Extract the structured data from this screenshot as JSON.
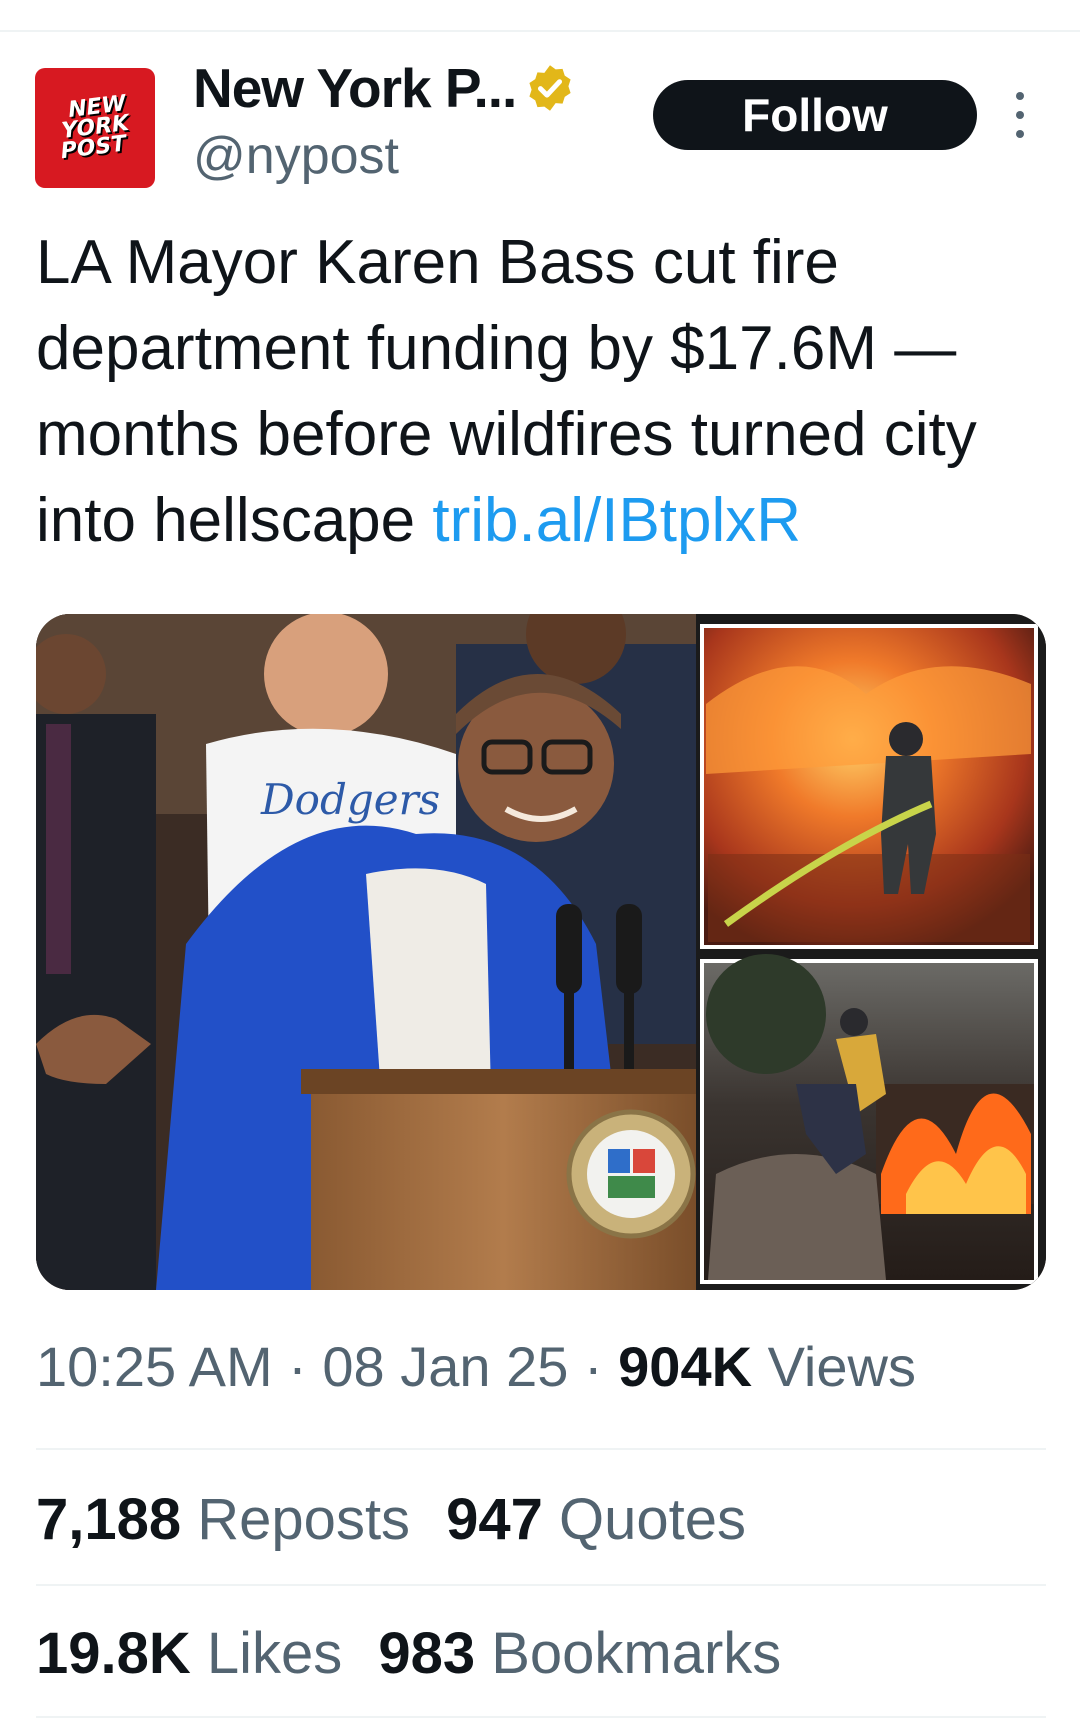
{
  "account": {
    "logo_lines": [
      "NEW",
      "YORK",
      "POST"
    ],
    "display_name": "New York P...",
    "handle": "@nypost",
    "verified_color": "#e2b719"
  },
  "follow_label": "Follow",
  "tweet": {
    "text": "LA Mayor Karen Bass cut fire department funding by $17.6M — months before wildfires turned city into hellscape",
    "link": "trib.al/IBtplxR",
    "link_color": "#1d9bf0"
  },
  "media": {
    "main_image": "mayor-at-podium-photo",
    "jersey_text": "Dodgers",
    "inset_images": [
      "firefighter-in-flames-photo",
      "firefighter-jumping-wall-photo"
    ]
  },
  "meta": {
    "time": "10:25 AM",
    "date": "08 Jan 25",
    "views_count": "904K",
    "views_label": "Views",
    "separator": "·"
  },
  "stats": {
    "reposts_count": "7,188",
    "reposts_label": "Reposts",
    "quotes_count": "947",
    "quotes_label": "Quotes",
    "likes_count": "19.8K",
    "likes_label": "Likes",
    "bookmarks_count": "983",
    "bookmarks_label": "Bookmarks"
  }
}
